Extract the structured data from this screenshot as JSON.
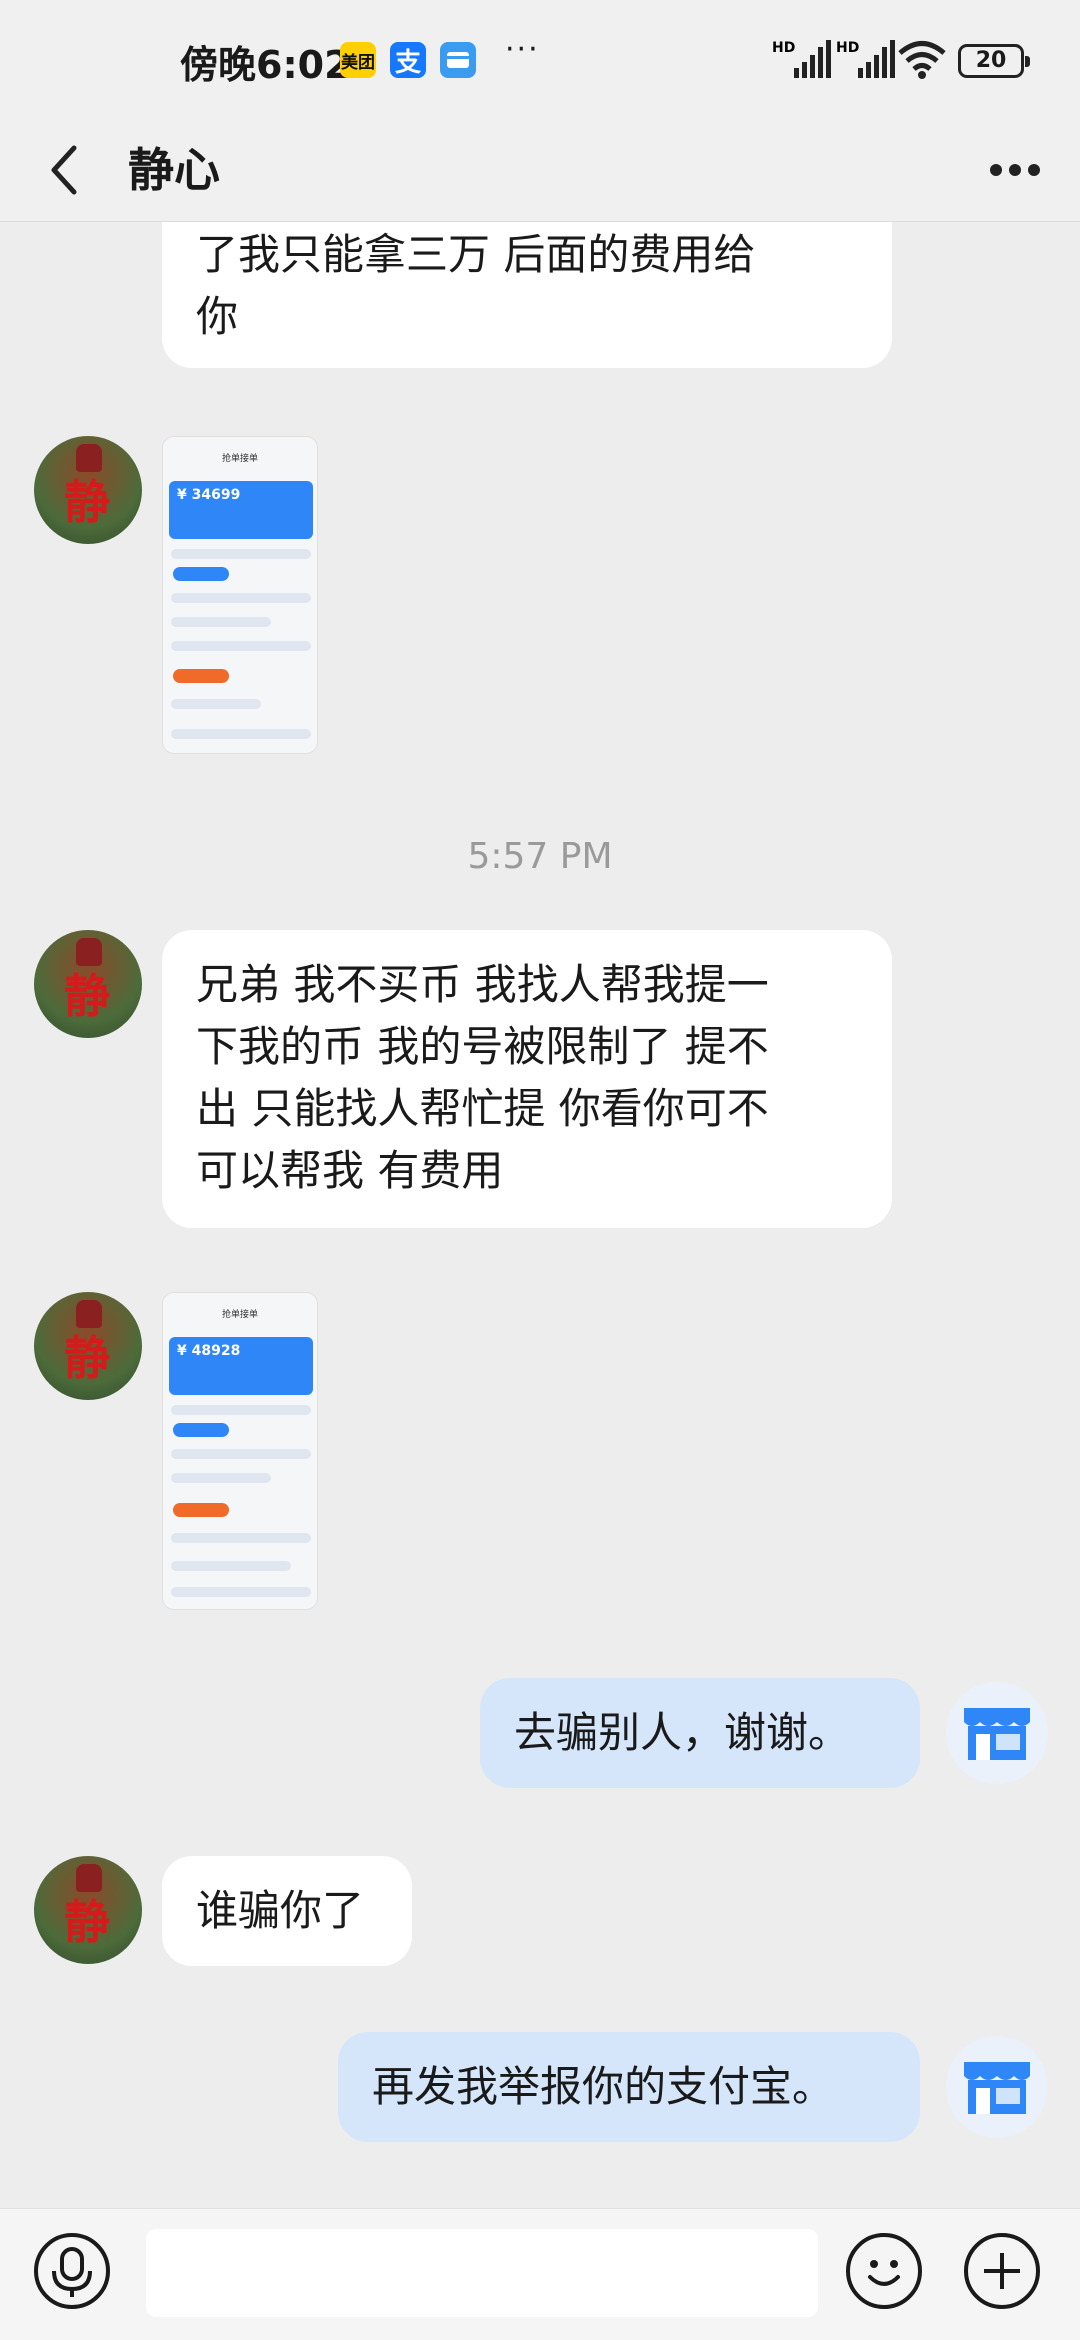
{
  "status_bar": {
    "time": "傍晚6:02",
    "app_icons": [
      "美团",
      "支",
      "card"
    ],
    "overflow": "···",
    "signal1_label": "HD",
    "signal2_label": "HD",
    "battery": "20"
  },
  "header": {
    "title": "静心"
  },
  "messages": [
    {
      "from": "other",
      "type": "text",
      "text": "了我只能拿三万 后面的费用给你",
      "lines": [
        "了我只能拿三万 后面的费用给",
        "你"
      ]
    },
    {
      "from": "other",
      "type": "image",
      "preview": {
        "amount": "¥ 34699",
        "header": "抢单接单"
      }
    },
    {
      "type": "timestamp",
      "text": "5:57 PM"
    },
    {
      "from": "other",
      "type": "text",
      "lines": [
        "兄弟 我不买币 我找人帮我提一",
        "下我的币 我的号被限制了 提不",
        "出 只能找人帮忙提 你看你可不",
        "可以帮我 有费用"
      ]
    },
    {
      "from": "other",
      "type": "image",
      "preview": {
        "amount": "¥ 48928",
        "header": "抢单接单"
      }
    },
    {
      "from": "me",
      "type": "text",
      "text": "去骗别人，谢谢。"
    },
    {
      "from": "other",
      "type": "text",
      "text": "谁骗你了"
    },
    {
      "from": "me",
      "type": "text",
      "text": "再发我举报你的支付宝。"
    }
  ],
  "avatar_char": "静"
}
